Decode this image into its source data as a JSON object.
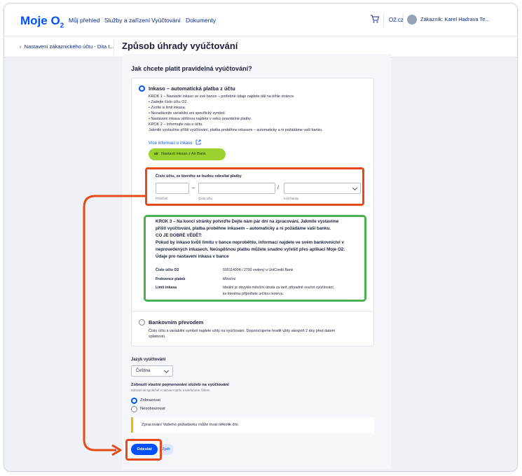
{
  "header": {
    "logo": "Moje O",
    "logo_sub": "2",
    "nav": [
      "Můj přehled",
      "Služby a zařízení",
      "Vyúčtování",
      "Dokumenty"
    ],
    "o2cz": "O2.cz",
    "customer": "Zákazník: Karel Hadrava Te..."
  },
  "subheader": {
    "back": "Nastavení zákaznického účtu - Dita t...",
    "title": "Způsob úhrady vyúčtování"
  },
  "question": "Jak chcete platit pravidelná vyúčtování?",
  "inkaso": {
    "label": "Inkaso – automatická platba z účtu",
    "lines": [
      "KROK 1 – Nastavte inkaso ve své bance – potřebné údaje najdete dál na téhle stránce.",
      "•  Zadejte číslo účtu O2.",
      "•  Zvolte si limit inkasa.",
      "•  Nezadávejte variabilní ani specifický symbol.",
      "•  Nastavení inkasa většinou najdete v sekci pravidelné platby.",
      "KROK 2 – Informujte nás o účtu.",
      "Jakmile vystavíme příští vyúčtování, platba proběhne inkasem – automaticky a ni požádáme vaši banku."
    ],
    "more_link": "Více informací o inkasu",
    "air_prefix": "air",
    "air_button": "Nastavit inkaso z Air Bank"
  },
  "account": {
    "label": "Číslo účtu, ze kterého se budou odesílat platby",
    "prefix_label": "Předčíslí",
    "number_label": "Číslo účtu",
    "bank_label": "Kód banky",
    "dash": "–",
    "slash": "/"
  },
  "info": {
    "title_lines": [
      "KROK 3 – Na konci stránky potvrďte Dejte nám pár dní na zpracování. Jakmile vystavíme",
      "příští vyúčtování, platba proběhne inkasem – automaticky a ni požádáme vaši banku.",
      "CO JE DOBRÉ VĚDĚT:",
      "Pokud by inkaso kvůli limitu v bance neproběhlo, informaci najdete ve svém bankovnictví v",
      "neprovedených inkasech. Neúspěšnou platbu můžete snadno vyřešit přes aplikaci Moje O2.",
      "Údaje pro nastavení inkasa v bance"
    ],
    "rows": [
      {
        "key": "Číslo účtu O2",
        "value": "500114004 / 2700 vedený u UniCredit Bank"
      },
      {
        "key": "Frekvence plateb",
        "value": "Měsíční"
      },
      {
        "key": "Limit inkasa",
        "value": "Ideální je obvyklá měsíční útrata za tarif, případně součet vyúčtování,\nke kterému připočtete určitou rezervu."
      }
    ]
  },
  "bank_transfer": {
    "label": "Bankovním převodem",
    "lines": [
      "Číslo účtu a variabilní symbol najdete vždy na vyúčtování. Doporučujeme hradit vždy alespoň 2 dny před datem",
      "splatnosti."
    ]
  },
  "language": {
    "label": "Jazyk vyúčtování",
    "selected": "Čeština"
  },
  "services": {
    "title": "Zobrazit vlastní pojmenování služeb na vyúčtování",
    "subtitle": "Zobrazí se společně s názvem tarifu a telefonním číslem",
    "options": [
      "Zobrazovat",
      "Nezobrazovat"
    ]
  },
  "notice": "Zpracování Vašeho požadavku může trvat několik dní.",
  "buttons": {
    "send": "Odeslat",
    "back": "Zpět"
  },
  "colors": {
    "accent": "#0050ff",
    "annotation_red": "#e64a19",
    "annotation_green": "#4caf50",
    "airbank": "#9ad330"
  }
}
